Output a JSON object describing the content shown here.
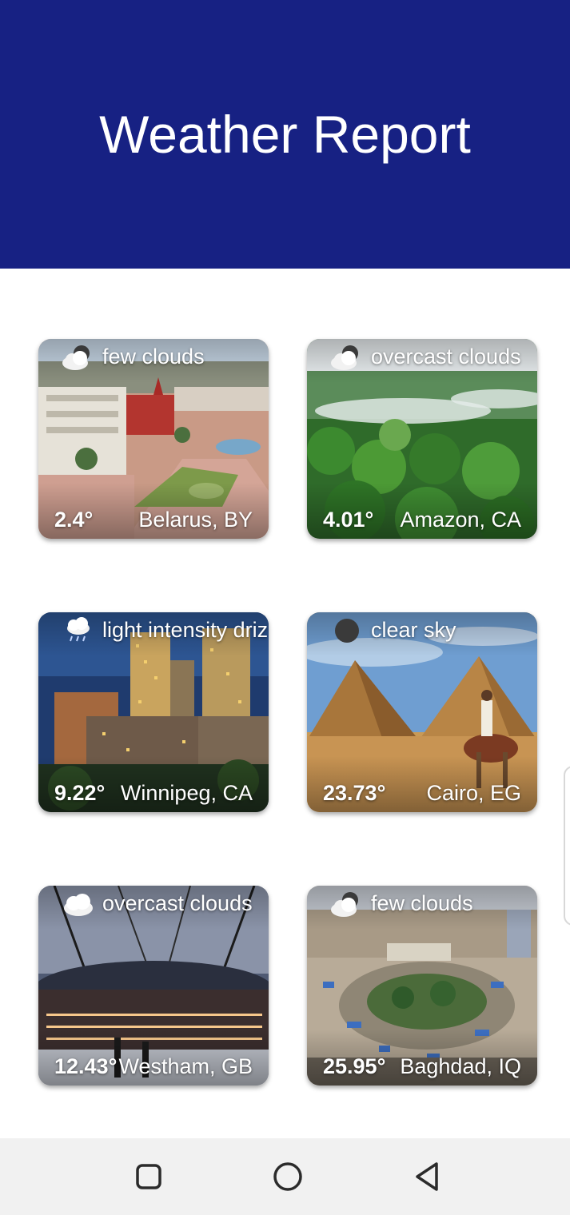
{
  "header": {
    "title": "Weather Report",
    "color": "#172183"
  },
  "cards": [
    {
      "description": "few clouds",
      "temperature": "2.4°",
      "location": "Belarus, BY",
      "icon": "cloud-icon"
    },
    {
      "description": "overcast clouds",
      "temperature": "4.01°",
      "location": "Amazon, CA",
      "icon": "cloud-icon"
    },
    {
      "description": "light intensity driz",
      "temperature": "9.22°",
      "location": "Winnipeg, CA",
      "icon": "drizzle-cloud-icon"
    },
    {
      "description": "clear sky",
      "temperature": "23.73°",
      "location": "Cairo, EG",
      "icon": "clear-sky-icon"
    },
    {
      "description": "overcast clouds",
      "temperature": "12.43°",
      "location": "Westham, GB",
      "icon": "cloud-icon"
    },
    {
      "description": "few clouds",
      "temperature": "25.95°",
      "location": "Baghdad, IQ",
      "icon": "cloud-icon"
    }
  ],
  "navbar": {
    "buttons": [
      "recent-apps-icon",
      "home-icon",
      "back-icon"
    ]
  }
}
